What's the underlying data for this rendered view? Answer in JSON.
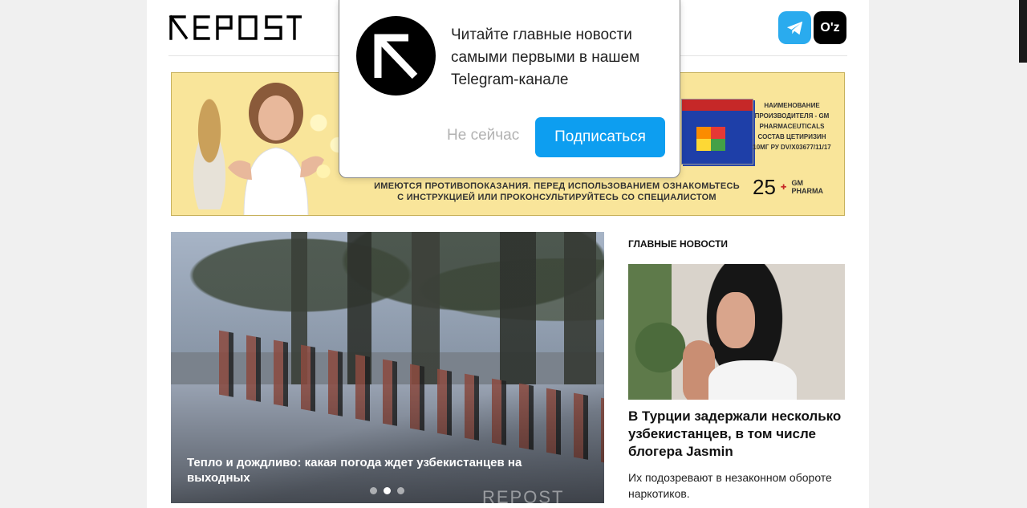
{
  "header": {
    "logo_text": "REPOST",
    "lang_label": "O'z"
  },
  "banner": {
    "warning_line1": "ИМЕЮТСЯ ПРОТИВОПОКАЗАНИЯ. ПЕРЕД ИСПОЛЬЗОВАНИЕМ ОЗНАКОМЬТЕСЬ",
    "warning_line2": "С ИНСТРУКЦИЕЙ ИЛИ ПРОКОНСУЛЬТИРУЙТЕСЬ СО СПЕЦИАЛИСТОМ",
    "info_lines": [
      "НАИМЕНОВАНИЕ",
      "ПРОИЗВОДИТЕЛЯ - GM",
      "PHARMACEUTICALS",
      "СОСТАВ ЦЕТИРИЗИН",
      "10МГ РУ DV/X03677/11/17"
    ],
    "badge_number": "25",
    "badge_text": "GM PHARMA"
  },
  "slider": {
    "caption": "Тепло и дождливо: какая погода ждет узбекистанцев на выходных",
    "watermark": "REPOST",
    "active_slide": 2,
    "slide_count": 3
  },
  "sidebar": {
    "section_title": "ГЛАВНЫЕ НОВОСТИ",
    "headline": "В Турции задержали несколько узбекистанцев, в том числе блогера Jasmin",
    "lead": "Их подозревают в незаконном обороте наркотиков."
  },
  "popup": {
    "text": "Читайте главные новости самыми первыми в нашем Telegram-канале",
    "later_label": "Не сейчас",
    "subscribe_label": "Подписаться"
  },
  "colors": {
    "telegram": "#2AABEE",
    "subscribe": "#0d9ef0",
    "banner_bg": "#f9e59a"
  }
}
